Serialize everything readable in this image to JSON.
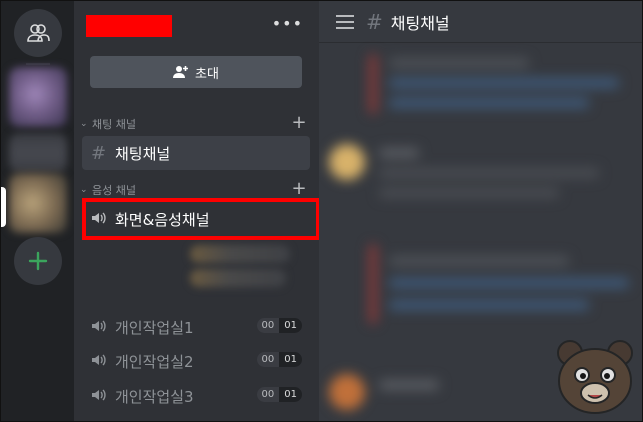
{
  "server": {
    "invite_label": "초대",
    "menu_glyph": "•••"
  },
  "categories": [
    {
      "label": "채팅 채널",
      "add_glyph": "+"
    },
    {
      "label": "음성 채널",
      "add_glyph": "+"
    }
  ],
  "text_channels": [
    {
      "name": "채팅채널",
      "icon": "hash-icon",
      "selected": true
    }
  ],
  "voice_channels": [
    {
      "name": "화면&음성채널",
      "icon": "speaker-icon",
      "highlighted": true
    },
    {
      "name": "개인작업실1",
      "icon": "speaker-icon",
      "count": "00",
      "limit": "01"
    },
    {
      "name": "개인작업실2",
      "icon": "speaker-icon",
      "count": "00",
      "limit": "01"
    },
    {
      "name": "개인작업실3",
      "icon": "speaker-icon",
      "count": "00",
      "limit": "01"
    }
  ],
  "header": {
    "channel_title": "채팅채널"
  },
  "colors": {
    "rail": "#202225",
    "sidebar": "#2f3136",
    "main": "#36393f",
    "highlight": "#ff0000",
    "add_server": "#3ba55d"
  }
}
